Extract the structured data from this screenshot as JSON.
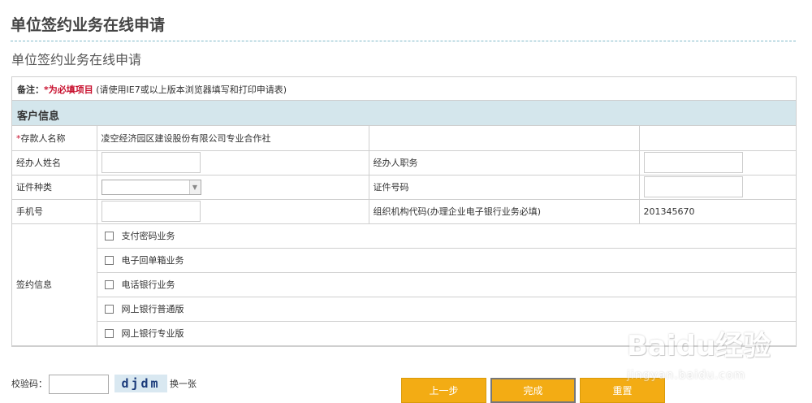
{
  "page": {
    "title": "单位签约业务在线申请",
    "subtitle": "单位签约业务在线申请"
  },
  "note": {
    "label": "备注：",
    "required": "*为必填项目",
    "text": "(请使用IE7或以上版本浏览器填写和打印申请表)"
  },
  "section": {
    "title": "客户信息"
  },
  "fields": {
    "depositor_star": "*",
    "depositor_label": "存款人名称",
    "depositor_value": "凌空经济园区建设股份有限公司专业合作社",
    "agent_name_label": "经办人姓名",
    "agent_name_value": "",
    "agent_title_label": "经办人职务",
    "agent_title_value": "",
    "id_type_label": "证件种类",
    "id_type_value": "",
    "id_number_label": "证件号码",
    "id_number_value": "",
    "phone_label": "手机号",
    "phone_value": "",
    "org_code_label": "组织机构代码(办理企业电子银行业务必填)",
    "org_code_value": "201345670"
  },
  "signing": {
    "label": "签约信息",
    "options": [
      {
        "label": "支付密码业务",
        "checked": false
      },
      {
        "label": "电子回单箱业务",
        "checked": false
      },
      {
        "label": "电话银行业务",
        "checked": false
      },
      {
        "label": "网上银行普通版",
        "checked": false
      },
      {
        "label": "网上银行专业版",
        "checked": false
      }
    ]
  },
  "captcha": {
    "label": "校验码：",
    "value": "",
    "image_text": "djdm",
    "refresh_label": "换一张"
  },
  "buttons": {
    "prev": "上一步",
    "done": "完成",
    "reset": "重置"
  },
  "watermark": {
    "main": "Baidu经验",
    "sub": "jingyan.baidu.com"
  },
  "colors": {
    "button": "#f3ac14",
    "section_header": "#d4e6ec",
    "required": "#c8102e"
  }
}
